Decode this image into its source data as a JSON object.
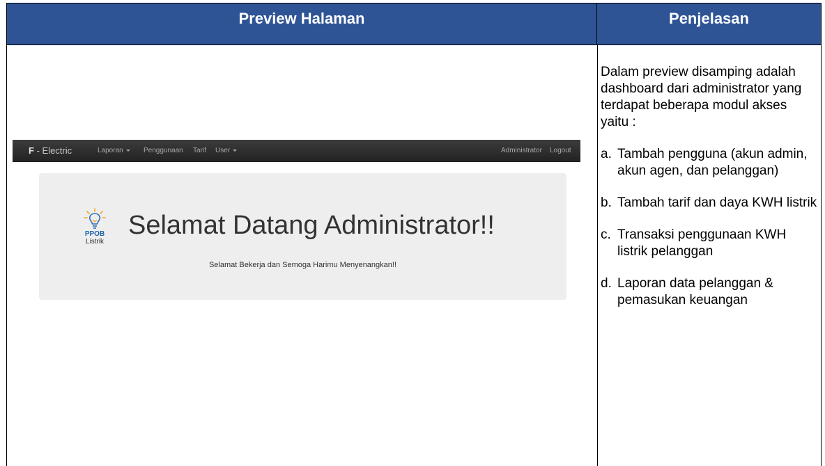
{
  "headers": {
    "left": "Preview Halaman",
    "right": "Penjelasan"
  },
  "preview": {
    "navbar": {
      "brand_bold": "F",
      "brand_rest": " - Electric",
      "items": [
        "Laporan",
        "Penggunaan",
        "Tarif",
        "User"
      ],
      "right_items": [
        "Administrator",
        "Logout"
      ]
    },
    "logo": {
      "line1": "PPOB",
      "line2": "Listrik"
    },
    "title": "Selamat Datang Administrator!!",
    "subtitle": "Selamat Bekerja dan Semoga Harimu Menyenangkan!!"
  },
  "explanation": {
    "intro": "Dalam preview disamping adalah dashboard dari administrator yang terdapat beberapa modul akses yaitu :",
    "items": [
      {
        "marker": "a.",
        "text": "Tambah pengguna (akun admin, akun agen, dan pelanggan)"
      },
      {
        "marker": "b.",
        "text": "Tambah tarif dan daya KWH listrik"
      },
      {
        "marker": "c.",
        "text": "Transaksi penggunaan KWH listrik pelanggan"
      },
      {
        "marker": "d.",
        "text": "Laporan data pelanggan & pemasukan keuangan"
      }
    ]
  },
  "colors": {
    "header_bg": "#2f5496",
    "navbar_bg": "#222222",
    "jumbotron_bg": "#eeeeee"
  }
}
